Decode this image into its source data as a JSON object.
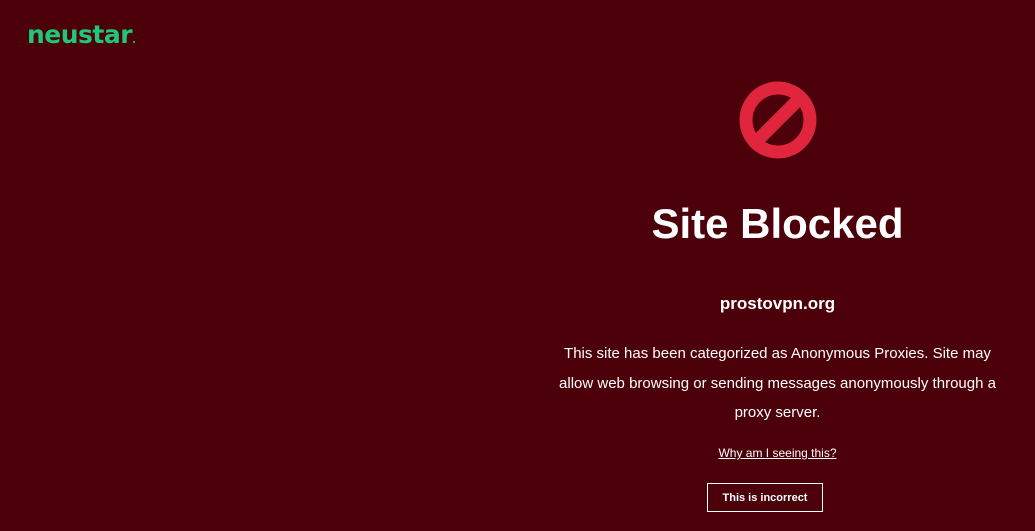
{
  "brand": {
    "logo_text": "neustar",
    "logo_mark": ".",
    "logo_color": "#1fc779"
  },
  "colors": {
    "background": "#4b000a",
    "icon": "#e0253c",
    "text": "#ffffff"
  },
  "block": {
    "icon": "prohibited-icon",
    "title": "Site Blocked",
    "domain": "prostovpn.org",
    "description": "This site has been categorized as Anonymous Proxies. Site may allow web browsing or sending messages anonymously through a proxy server.",
    "why_link": "Why am I seeing this?",
    "incorrect_button": "This is incorrect"
  }
}
